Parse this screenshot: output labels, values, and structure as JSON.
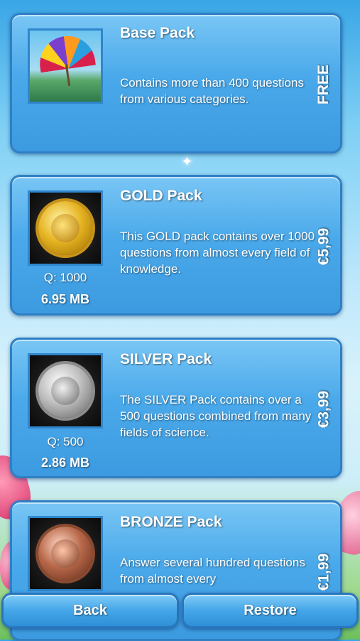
{
  "packs": [
    {
      "title": "Base Pack",
      "description": "Contains more than 400 questions from various categories.",
      "price": "FREE",
      "image": "umbrella-thumbnail"
    },
    {
      "title": "GOLD Pack",
      "description": "This GOLD pack contains over 1000 questions from almost every field of knowledge.",
      "price": "€5,99",
      "questions": "Q: 1000",
      "size": "6.95 MB",
      "image": "gold-globe-medal-icon"
    },
    {
      "title": "SILVER Pack",
      "description": "The SILVER Pack contains over a 500 questions combined from many fields of science.",
      "price": "€3,99",
      "questions": "Q: 500",
      "size": "2.86 MB",
      "image": "silver-globe-medal-icon"
    },
    {
      "title": "BRONZE Pack",
      "description": "Answer several hundred questions from almost every",
      "price": "€1,99",
      "image": "bronze-globe-medal-icon"
    }
  ],
  "buttons": {
    "back": "Back",
    "restore": "Restore"
  },
  "colors": {
    "card": "#4aa9ea",
    "card_border": "#2f7fc4",
    "text": "#ffffff"
  }
}
